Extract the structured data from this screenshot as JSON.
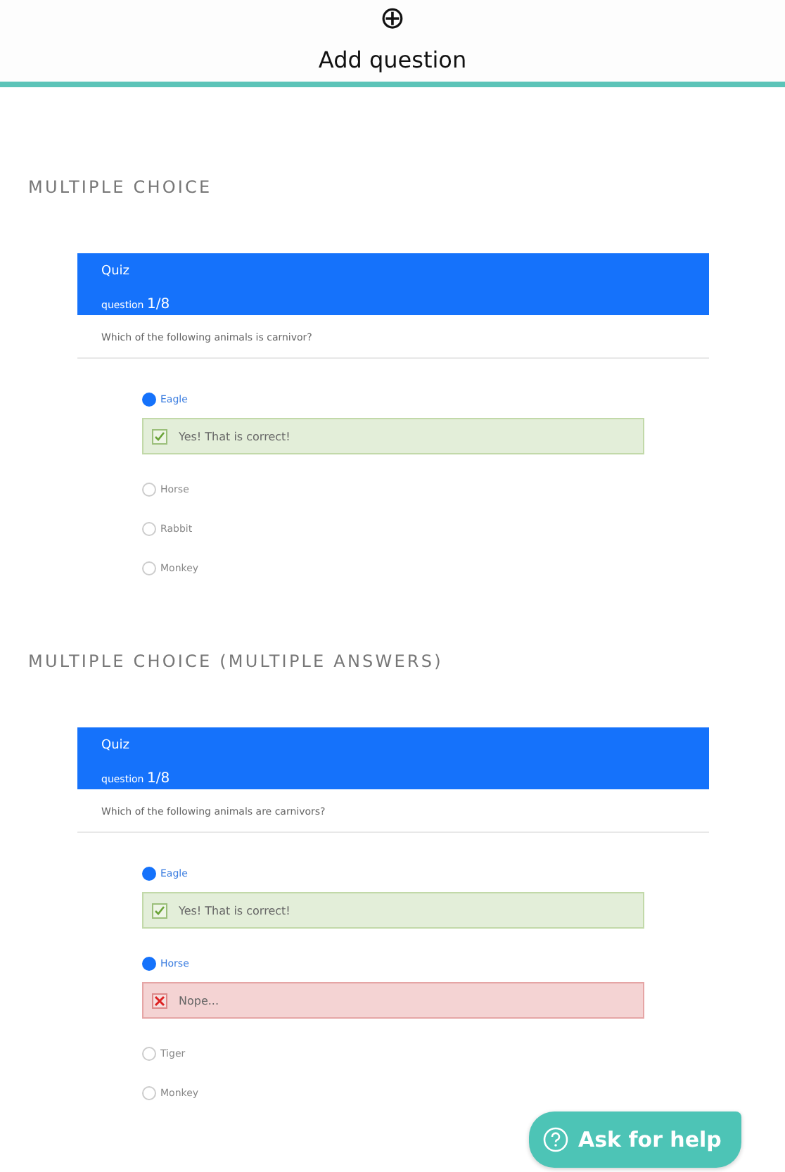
{
  "header": {
    "icon": "⊕",
    "label": "Add question"
  },
  "sections": [
    {
      "heading": "MULTIPLE CHOICE",
      "quiz": {
        "title": "Quiz",
        "progress_label": "question",
        "progress": "1/8",
        "question": "Which of the following animals is carnivor?",
        "options": [
          {
            "label": "Eagle",
            "selected": true,
            "feedback": {
              "kind": "correct",
              "text": "Yes! That is correct!"
            }
          },
          {
            "label": "Horse",
            "selected": false
          },
          {
            "label": "Rabbit",
            "selected": false
          },
          {
            "label": "Monkey",
            "selected": false
          }
        ]
      }
    },
    {
      "heading": "MULTIPLE CHOICE (MULTIPLE ANSWERS)",
      "quiz": {
        "title": "Quiz",
        "progress_label": "question",
        "progress": "1/8",
        "question": "Which of the following animals are carnivors?",
        "options": [
          {
            "label": "Eagle",
            "selected": true,
            "feedback": {
              "kind": "correct",
              "text": "Yes! That is correct!"
            }
          },
          {
            "label": "Horse",
            "selected": true,
            "feedback": {
              "kind": "wrong",
              "text": "Nope..."
            }
          },
          {
            "label": "Tiger",
            "selected": false
          },
          {
            "label": "Monkey",
            "selected": false
          }
        ]
      }
    }
  ],
  "help_button": {
    "label": "Ask for help"
  }
}
